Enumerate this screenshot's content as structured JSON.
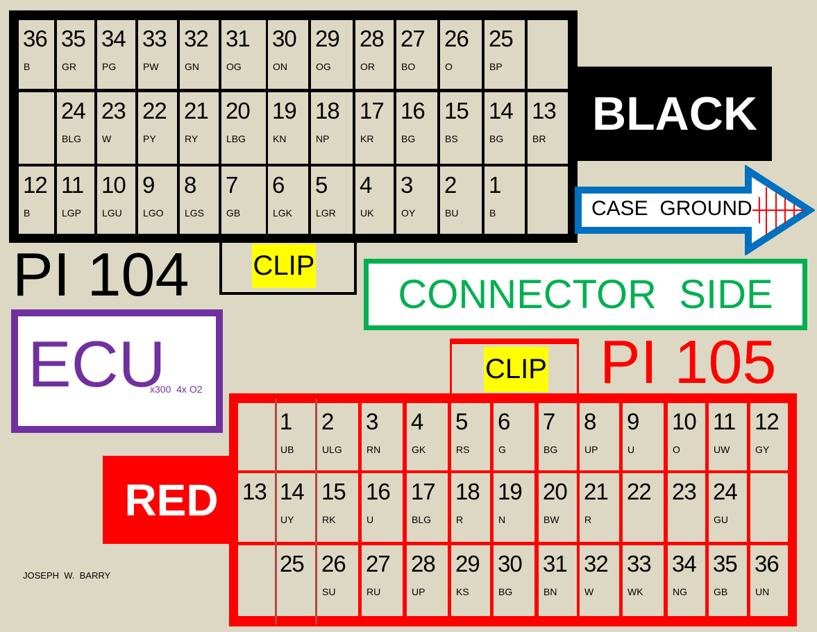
{
  "colors": {
    "background": "#ddd8c3",
    "black_connector": "#000000",
    "red_connector": "#ff0000",
    "ecu_purple": "#7030a0",
    "connector_side_green": "#00b050",
    "case_ground_blue": "#0070c0",
    "clip_yellow": "#ffff00"
  },
  "pi104": {
    "title": "PI 104",
    "label": "BLACK",
    "clip": "CLIP",
    "rows": [
      [
        {
          "num": "36",
          "code": "B"
        },
        {
          "num": "35",
          "code": "GR"
        },
        {
          "num": "34",
          "code": "PG"
        },
        {
          "num": "33",
          "code": "PW"
        },
        {
          "num": "32",
          "code": "GN"
        },
        {
          "num": "31",
          "code": "OG"
        },
        {
          "num": "30",
          "code": "ON"
        },
        {
          "num": "29",
          "code": "OG"
        },
        {
          "num": "28",
          "code": "OR"
        },
        {
          "num": "27",
          "code": "BO"
        },
        {
          "num": "26",
          "code": "O"
        },
        {
          "num": "25",
          "code": "BP"
        },
        {
          "num": "",
          "code": ""
        }
      ],
      [
        {
          "num": "",
          "code": ""
        },
        {
          "num": "24",
          "code": "BLG"
        },
        {
          "num": "23",
          "code": "W"
        },
        {
          "num": "22",
          "code": "PY"
        },
        {
          "num": "21",
          "code": "RY"
        },
        {
          "num": "20",
          "code": "LBG"
        },
        {
          "num": "19",
          "code": "KN"
        },
        {
          "num": "18",
          "code": "NP"
        },
        {
          "num": "17",
          "code": "KR"
        },
        {
          "num": "16",
          "code": "BG"
        },
        {
          "num": "15",
          "code": "BS"
        },
        {
          "num": "14",
          "code": "BG"
        },
        {
          "num": "13",
          "code": "BR"
        }
      ],
      [
        {
          "num": "12",
          "code": "B"
        },
        {
          "num": "11",
          "code": "LGP"
        },
        {
          "num": "10",
          "code": "LGU"
        },
        {
          "num": "9",
          "code": "LGO"
        },
        {
          "num": "8",
          "code": "LGS"
        },
        {
          "num": "7",
          "code": "GB"
        },
        {
          "num": "6",
          "code": "LGK"
        },
        {
          "num": "5",
          "code": "LGR"
        },
        {
          "num": "4",
          "code": "UK"
        },
        {
          "num": "3",
          "code": "OY"
        },
        {
          "num": "2",
          "code": "BU"
        },
        {
          "num": "1",
          "code": "B"
        },
        {
          "num": "",
          "code": ""
        }
      ]
    ]
  },
  "pi105": {
    "title": "PI 105",
    "label": "RED",
    "clip": "CLIP",
    "rows": [
      [
        {
          "num": "",
          "code": ""
        },
        {
          "num": "1",
          "code": "UB"
        },
        {
          "num": "2",
          "code": "ULG"
        },
        {
          "num": "3",
          "code": "RN"
        },
        {
          "num": "4",
          "code": "GK"
        },
        {
          "num": "5",
          "code": "RS"
        },
        {
          "num": "6",
          "code": "G"
        },
        {
          "num": "7",
          "code": "BG"
        },
        {
          "num": "8",
          "code": "UP"
        },
        {
          "num": "9",
          "code": "U"
        },
        {
          "num": "10",
          "code": "O"
        },
        {
          "num": "11",
          "code": "UW"
        },
        {
          "num": "12",
          "code": "GY"
        }
      ],
      [
        {
          "num": "13",
          "code": ""
        },
        {
          "num": "14",
          "code": "UY"
        },
        {
          "num": "15",
          "code": "RK"
        },
        {
          "num": "16",
          "code": "U"
        },
        {
          "num": "17",
          "code": "BLG"
        },
        {
          "num": "18",
          "code": "R"
        },
        {
          "num": "19",
          "code": "N"
        },
        {
          "num": "20",
          "code": "BW"
        },
        {
          "num": "21",
          "code": "R"
        },
        {
          "num": "22",
          "code": ""
        },
        {
          "num": "23",
          "code": ""
        },
        {
          "num": "24",
          "code": "GU"
        },
        {
          "num": "",
          "code": ""
        }
      ],
      [
        {
          "num": "",
          "code": ""
        },
        {
          "num": "25",
          "code": ""
        },
        {
          "num": "26",
          "code": "SU"
        },
        {
          "num": "27",
          "code": "RU"
        },
        {
          "num": "28",
          "code": "UP"
        },
        {
          "num": "29",
          "code": "KS"
        },
        {
          "num": "30",
          "code": "BG"
        },
        {
          "num": "31",
          "code": "BN"
        },
        {
          "num": "32",
          "code": "W"
        },
        {
          "num": "33",
          "code": "WK"
        },
        {
          "num": "34",
          "code": "NG"
        },
        {
          "num": "35",
          "code": "GB"
        },
        {
          "num": "36",
          "code": "UN"
        }
      ]
    ]
  },
  "case_ground": "CASE  GROUND",
  "connector_side": "CONNECTOR  SIDE",
  "ecu": {
    "title": "ECU",
    "subtitle": "x300  4x O2"
  },
  "author": "JOSEPH  W.  BARRY"
}
